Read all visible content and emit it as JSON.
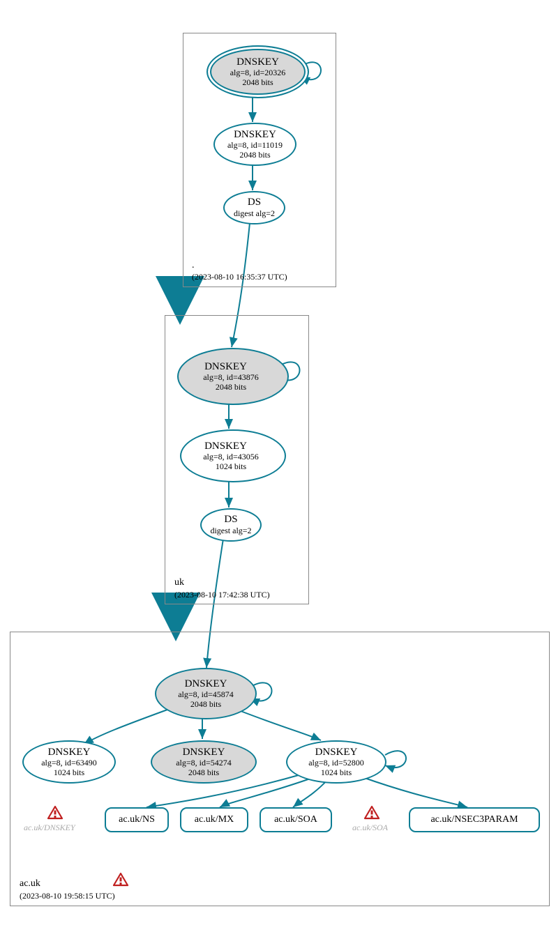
{
  "root": {
    "dot_label": ".",
    "timestamp": "(2023-08-10 16:35:37 UTC)",
    "dnskey1": {
      "title": "DNSKEY",
      "line1": "alg=8, id=20326",
      "line2": "2048 bits"
    },
    "dnskey2": {
      "title": "DNSKEY",
      "line1": "alg=8, id=11019",
      "line2": "2048 bits"
    },
    "ds": {
      "title": "DS",
      "line1": "digest alg=2"
    }
  },
  "uk": {
    "label": "uk",
    "timestamp": "(2023-08-10 17:42:38 UTC)",
    "dnskey1": {
      "title": "DNSKEY",
      "line1": "alg=8, id=43876",
      "line2": "2048 bits"
    },
    "dnskey2": {
      "title": "DNSKEY",
      "line1": "alg=8, id=43056",
      "line2": "1024 bits"
    },
    "ds": {
      "title": "DS",
      "line1": "digest alg=2"
    }
  },
  "acuk": {
    "label": "ac.uk",
    "timestamp": "(2023-08-10 19:58:15 UTC)",
    "dnskey1": {
      "title": "DNSKEY",
      "line1": "alg=8, id=45874",
      "line2": "2048 bits"
    },
    "dnskey2": {
      "title": "DNSKEY",
      "line1": "alg=8, id=63490",
      "line2": "1024 bits"
    },
    "dnskey3": {
      "title": "DNSKEY",
      "line1": "alg=8, id=54274",
      "line2": "2048 bits"
    },
    "dnskey4": {
      "title": "DNSKEY",
      "line1": "alg=8, id=52800",
      "line2": "1024 bits"
    },
    "rr_ns": "ac.uk/NS",
    "rr_mx": "ac.uk/MX",
    "rr_soa": "ac.uk/SOA",
    "rr_nsec3": "ac.uk/NSEC3PARAM",
    "ghost_dnskey": "ac.uk/DNSKEY",
    "ghost_soa": "ac.uk/SOA"
  }
}
